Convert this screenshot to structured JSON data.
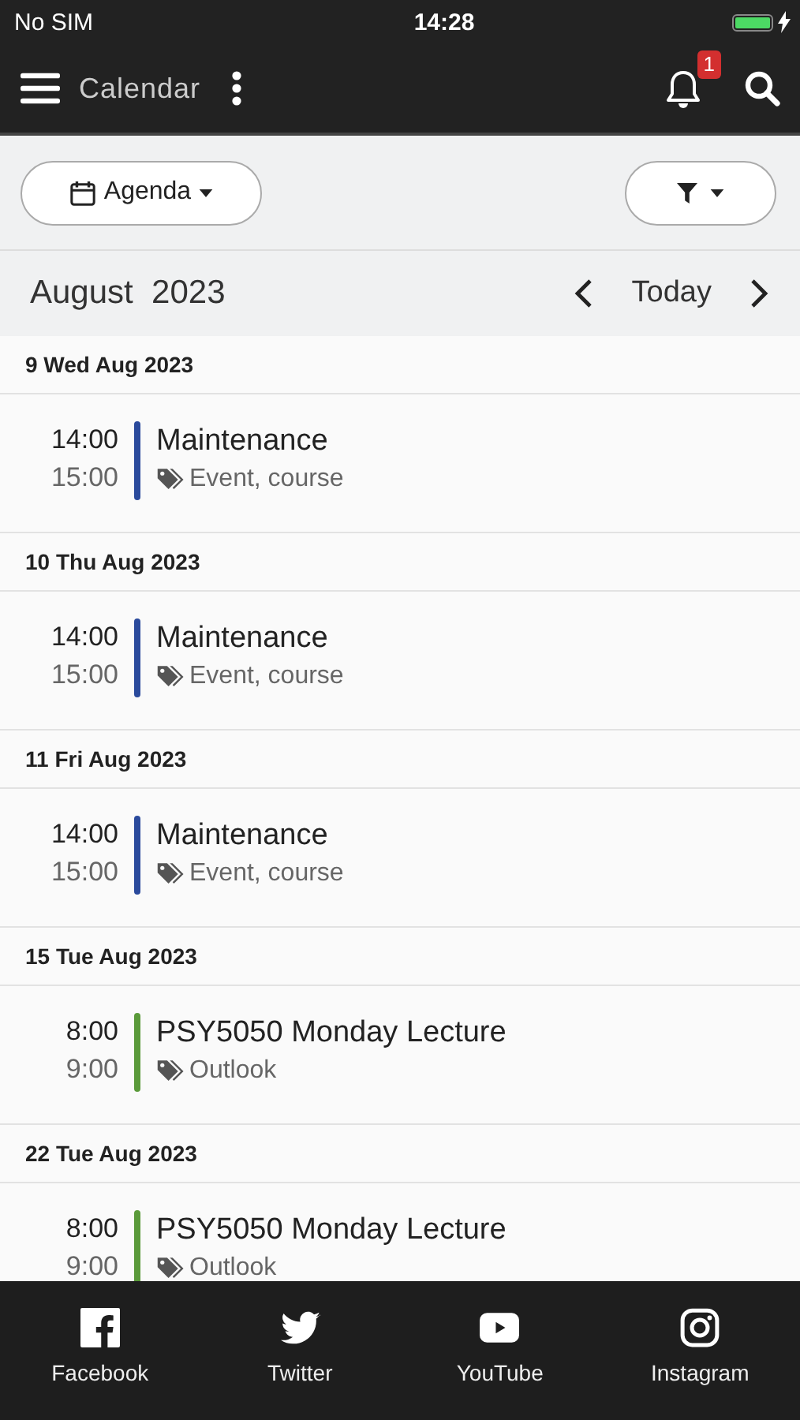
{
  "status_bar": {
    "carrier": "No SIM",
    "time": "14:28",
    "charging": true
  },
  "header": {
    "title": "Calendar",
    "notification_count": "1"
  },
  "toolbar": {
    "view_button": "Agenda"
  },
  "month_nav": {
    "month": "August  2023",
    "today_button": "Today"
  },
  "days": [
    {
      "date": "9 Wed Aug 2023",
      "events": [
        {
          "start": "14:00",
          "end": "15:00",
          "title": "Maintenance",
          "tags": "Event, course",
          "color": "#2a4a9c"
        }
      ]
    },
    {
      "date": "10 Thu Aug 2023",
      "events": [
        {
          "start": "14:00",
          "end": "15:00",
          "title": "Maintenance",
          "tags": "Event, course",
          "color": "#2a4a9c"
        }
      ]
    },
    {
      "date": "11 Fri Aug 2023",
      "events": [
        {
          "start": "14:00",
          "end": "15:00",
          "title": "Maintenance",
          "tags": "Event, course",
          "color": "#2a4a9c"
        }
      ]
    },
    {
      "date": "15 Tue Aug 2023",
      "events": [
        {
          "start": "8:00",
          "end": "9:00",
          "title": "PSY5050 Monday Lecture",
          "tags": "Outlook",
          "color": "#5a9a3a"
        }
      ]
    },
    {
      "date": "22 Tue Aug 2023",
      "events": [
        {
          "start": "8:00",
          "end": "9:00",
          "title": "PSY5050 Monday Lecture",
          "tags": "Outlook",
          "color": "#5a9a3a"
        }
      ]
    }
  ],
  "tab_bar": [
    {
      "kind": "facebook",
      "label": "Facebook"
    },
    {
      "kind": "twitter",
      "label": "Twitter"
    },
    {
      "kind": "youtube",
      "label": "YouTube"
    },
    {
      "kind": "instagram",
      "label": "Instagram"
    }
  ]
}
